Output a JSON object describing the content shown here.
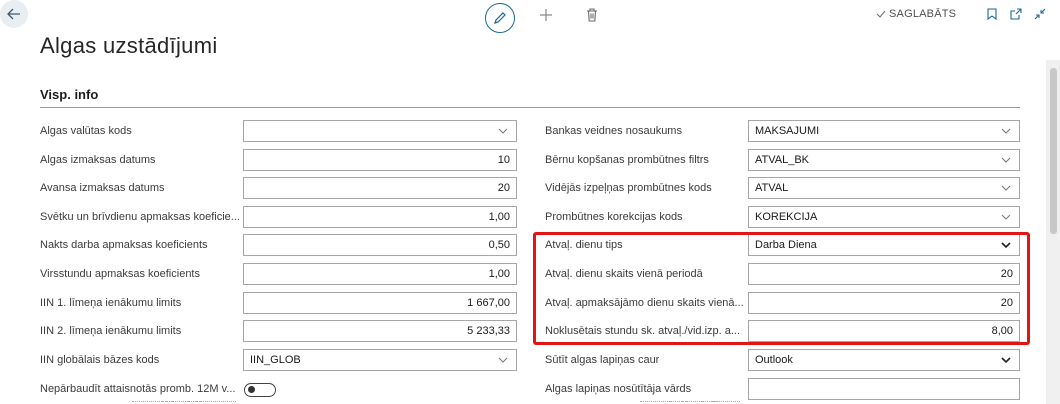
{
  "toolbar": {
    "saved_label": "SAGLABĀTS",
    "back_icon": "arrow-left-icon",
    "edit_icon": "pencil-icon",
    "add_icon": "plus-icon",
    "delete_icon": "trash-icon"
  },
  "page": {
    "title": "Algas uzstādījumi"
  },
  "section": {
    "title": "Visp. info"
  },
  "left_fields": [
    {
      "label": "Algas valūtas kods",
      "value": "",
      "kind": "select"
    },
    {
      "label": "Algas izmaksas datums",
      "value": "10",
      "kind": "number"
    },
    {
      "label": "Avansa izmaksas datums",
      "value": "20",
      "kind": "number"
    },
    {
      "label": "Svētku un brīvdienu apmaksas koeficie...",
      "value": "1,00",
      "kind": "number"
    },
    {
      "label": "Nakts darba apmaksas koeficients",
      "value": "0,50",
      "kind": "number"
    },
    {
      "label": "Virsstundu apmaksas koeficients",
      "value": "1,00",
      "kind": "number"
    },
    {
      "label": "IIN 1. līmeņa ienākumu limits",
      "value": "1 667,00",
      "kind": "number"
    },
    {
      "label": "IIN 2. līmeņa ienākumu limits",
      "value": "5 233,33",
      "kind": "number"
    },
    {
      "label": "IIN globālais bāzes kods",
      "value": "IIN_GLOB",
      "kind": "select"
    },
    {
      "label": "Nepārbaudīt attaisnotās promb. 12M v...",
      "value": "",
      "kind": "toggle"
    }
  ],
  "right_fields": [
    {
      "label": "Bankas veidnes nosaukums",
      "value": "MAKSAJUMI",
      "kind": "select"
    },
    {
      "label": "Bērnu kopšanas prombūtnes filtrs",
      "value": "ATVAL_BK",
      "kind": "select"
    },
    {
      "label": "Vidējās izpeļņas prombūtnes kods",
      "value": "ATVAL",
      "kind": "select"
    },
    {
      "label": "Prombūtnes korekcijas kods",
      "value": "KOREKCIJA",
      "kind": "select"
    },
    {
      "label": "Atvaļ. dienu tips",
      "value": "Darba Diena",
      "kind": "dropdown"
    },
    {
      "label": "Atvaļ. dienu skaits vienā periodā",
      "value": "20",
      "kind": "number"
    },
    {
      "label": "Atvaļ. apmaksājāmo dienu skaits vienā...",
      "value": "20",
      "kind": "number"
    },
    {
      "label": "Noklusētais stundu sk. atvaļ./vid.izp. a...",
      "value": "8,00",
      "kind": "number"
    },
    {
      "label": "Sūtīt algas lapiņas caur",
      "value": "Outlook",
      "kind": "dropdown"
    },
    {
      "label": "Algas lapiņas nosūtītāja vārds",
      "value": "",
      "kind": "text"
    }
  ],
  "colors": {
    "accent": "#1a6a93",
    "highlight": "#e31414"
  }
}
